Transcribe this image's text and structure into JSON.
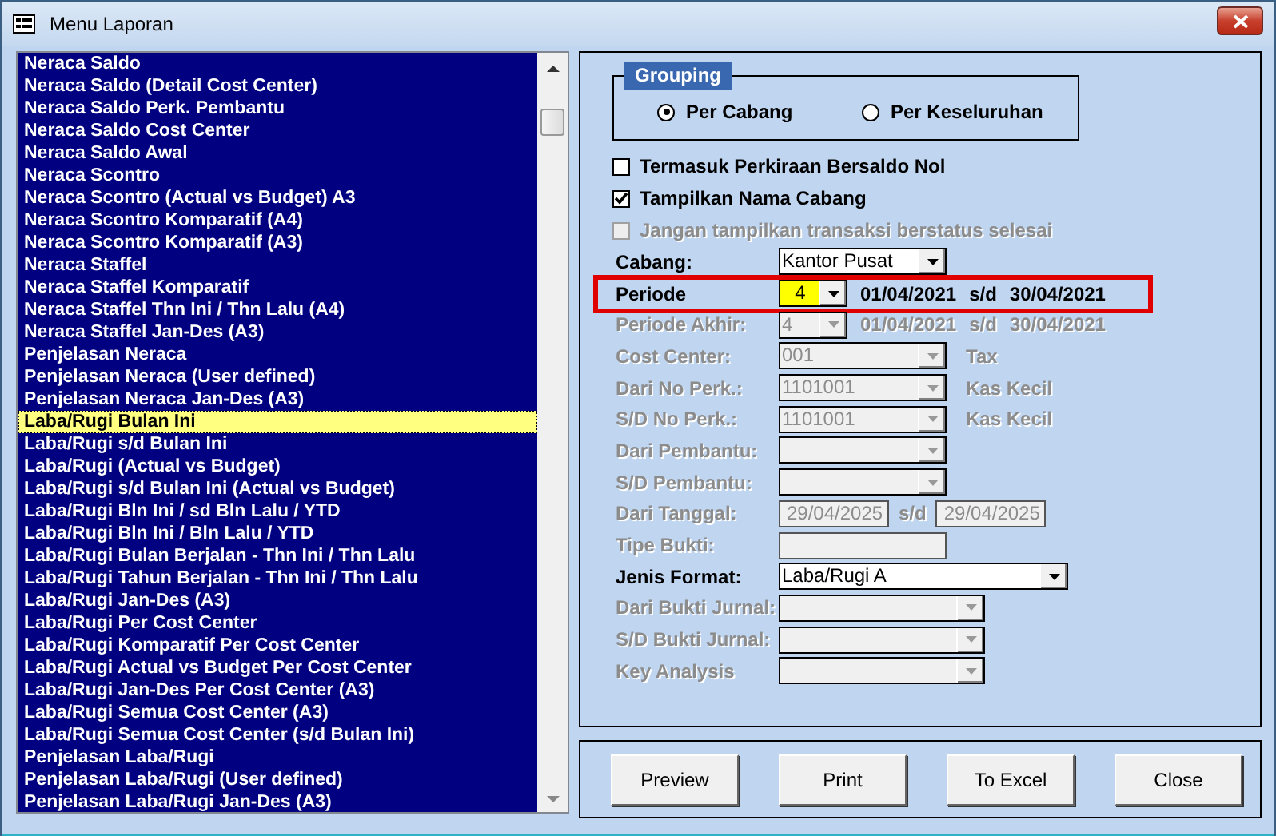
{
  "window": {
    "title": "Menu Laporan"
  },
  "reports": [
    {
      "label": "Neraca Saldo",
      "selected": false
    },
    {
      "label": "Neraca Saldo (Detail Cost Center)",
      "selected": false
    },
    {
      "label": "Neraca Saldo Perk. Pembantu",
      "selected": false
    },
    {
      "label": "Neraca Saldo Cost Center",
      "selected": false
    },
    {
      "label": "Neraca Saldo Awal",
      "selected": false
    },
    {
      "label": "Neraca Scontro",
      "selected": false
    },
    {
      "label": "Neraca Scontro (Actual vs Budget) A3",
      "selected": false
    },
    {
      "label": "Neraca Scontro Komparatif (A4)",
      "selected": false
    },
    {
      "label": "Neraca Scontro Komparatif (A3)",
      "selected": false
    },
    {
      "label": "Neraca Staffel",
      "selected": false
    },
    {
      "label": "Neraca Staffel Komparatif",
      "selected": false
    },
    {
      "label": "Neraca Staffel Thn Ini / Thn Lalu (A4)",
      "selected": false
    },
    {
      "label": "Neraca Staffel Jan-Des (A3)",
      "selected": false
    },
    {
      "label": "Penjelasan Neraca",
      "selected": false
    },
    {
      "label": "Penjelasan Neraca (User defined)",
      "selected": false
    },
    {
      "label": "Penjelasan Neraca Jan-Des (A3)",
      "selected": false
    },
    {
      "label": "Laba/Rugi Bulan Ini",
      "selected": true
    },
    {
      "label": "Laba/Rugi s/d Bulan Ini",
      "selected": false
    },
    {
      "label": "Laba/Rugi (Actual vs Budget)",
      "selected": false
    },
    {
      "label": "Laba/Rugi s/d Bulan Ini (Actual vs Budget)",
      "selected": false
    },
    {
      "label": "Laba/Rugi Bln Ini / sd Bln Lalu / YTD",
      "selected": false
    },
    {
      "label": "Laba/Rugi Bln Ini / Bln Lalu / YTD",
      "selected": false
    },
    {
      "label": "Laba/Rugi Bulan Berjalan - Thn Ini / Thn Lalu",
      "selected": false
    },
    {
      "label": "Laba/Rugi Tahun Berjalan - Thn Ini / Thn Lalu",
      "selected": false
    },
    {
      "label": "Laba/Rugi Jan-Des (A3)",
      "selected": false
    },
    {
      "label": "Laba/Rugi Per Cost Center",
      "selected": false
    },
    {
      "label": "Laba/Rugi Komparatif Per Cost Center",
      "selected": false
    },
    {
      "label": "Laba/Rugi Actual vs Budget Per Cost Center",
      "selected": false
    },
    {
      "label": "Laba/Rugi Jan-Des Per Cost Center (A3)",
      "selected": false
    },
    {
      "label": "Laba/Rugi Semua Cost Center (A3)",
      "selected": false
    },
    {
      "label": "Laba/Rugi Semua Cost Center (s/d Bulan Ini)",
      "selected": false
    },
    {
      "label": "Penjelasan Laba/Rugi",
      "selected": false
    },
    {
      "label": "Penjelasan Laba/Rugi (User defined)",
      "selected": false
    },
    {
      "label": "Penjelasan Laba/Rugi Jan-Des (A3)",
      "selected": false
    }
  ],
  "grouping": {
    "title": "Grouping",
    "options": [
      {
        "label": "Per Cabang",
        "selected": true
      },
      {
        "label": "Per Keseluruhan",
        "selected": false
      }
    ]
  },
  "checkboxes": [
    {
      "label": "Termasuk Perkiraan Bersaldo Nol",
      "checked": false,
      "disabled": false
    },
    {
      "label": "Tampilkan Nama Cabang",
      "checked": true,
      "disabled": false
    },
    {
      "label": "Jangan tampilkan transaksi berstatus selesai",
      "checked": false,
      "disabled": true
    }
  ],
  "fields": [
    {
      "label": "Cabang:",
      "kind": "combo",
      "value": "Kantor Pusat",
      "disabled": false,
      "highlighted": false
    },
    {
      "label": "Periode",
      "kind": "period",
      "value": "4",
      "from": "01/04/2021",
      "separator": "s/d",
      "to": "30/04/2021",
      "disabled": false,
      "highlighted": true
    },
    {
      "label": "Periode Akhir:",
      "kind": "period",
      "value": "4",
      "from": "01/04/2021",
      "separator": "s/d",
      "to": "30/04/2021",
      "disabled": true,
      "highlighted": false
    },
    {
      "label": "Cost Center:",
      "kind": "combo",
      "value": "001",
      "note": "Tax",
      "disabled": true,
      "highlighted": false
    },
    {
      "label": "Dari No Perk.:",
      "kind": "combo",
      "value": "1101001",
      "note": "Kas Kecil",
      "disabled": true,
      "highlighted": false
    },
    {
      "label": "S/D No Perk.:",
      "kind": "combo",
      "value": "1101001",
      "note": "Kas Kecil",
      "disabled": true,
      "highlighted": false
    },
    {
      "label": "Dari Pembantu:",
      "kind": "combo",
      "disabled": true,
      "highlighted": false
    },
    {
      "label": "S/D Pembantu:",
      "kind": "combo",
      "disabled": true,
      "highlighted": false
    },
    {
      "label": "Dari Tanggal:",
      "kind": "date-range",
      "from": "29/04/2025",
      "separator": "s/d",
      "to": "29/04/2025",
      "disabled": true,
      "highlighted": false
    },
    {
      "label": "Tipe Bukti:",
      "kind": "text",
      "disabled": true,
      "highlighted": false
    },
    {
      "label": "Jenis Format:",
      "kind": "wide-combo",
      "value": "Laba/Rugi A",
      "disabled": false,
      "highlighted": false
    },
    {
      "label": "Dari Bukti Jurnal:",
      "kind": "mid-combo",
      "disabled": true,
      "highlighted": false
    },
    {
      "label": "S/D Bukti Jurnal:",
      "kind": "mid-combo",
      "disabled": true,
      "highlighted": false
    },
    {
      "label": "Key Analysis",
      "kind": "mid-combo",
      "disabled": true,
      "highlighted": false
    }
  ],
  "buttons": [
    "Preview",
    "Print",
    "To Excel",
    "Close"
  ]
}
